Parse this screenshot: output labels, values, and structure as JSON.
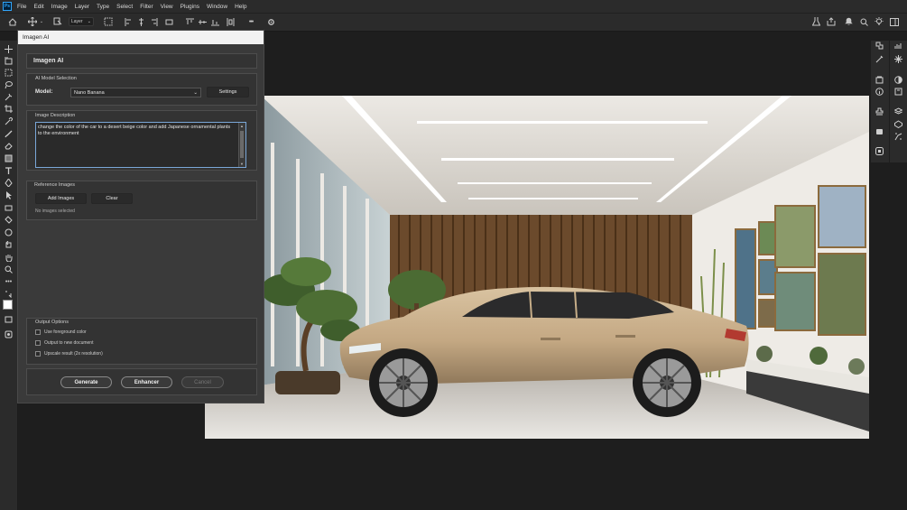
{
  "menubar": {
    "logo": "Ps",
    "items": [
      "File",
      "Edit",
      "Image",
      "Layer",
      "Type",
      "Select",
      "Filter",
      "View",
      "Plugins",
      "Window",
      "Help"
    ]
  },
  "optionsbar": {
    "layer_select": "Layer",
    "more": "•••"
  },
  "dialog": {
    "window_title": "Imagen AI",
    "header": "Imagen AI",
    "model_section": {
      "title": "AI Model Selection",
      "model_label": "Model:",
      "model_value": "Nano Banana",
      "settings_label": "Settings"
    },
    "description_section": {
      "title": "Image Description",
      "text": "change the color of the car to a desert beige color and add Japanese ornamental plants to the environment"
    },
    "reference_section": {
      "title": "Reference Images",
      "add_label": "Add Images",
      "clear_label": "Clear",
      "status": "No images selected"
    },
    "output_section": {
      "title": "Output Options",
      "options": [
        {
          "label": "Use foreground color",
          "checked": false
        },
        {
          "label": "Output to new document",
          "checked": false
        },
        {
          "label": "Upscale result (2x resolution)",
          "checked": false
        }
      ]
    },
    "actions": {
      "generate": "Generate",
      "enhancer": "Enhancer",
      "cancel": "Cancel"
    }
  },
  "colors": {
    "app_bg": "#1e1e1e",
    "panel": "#2b2b2b",
    "dialog_bg": "#3a3a3a",
    "car_body": "#c9b08c",
    "wood_slats": "#6b4a2c"
  }
}
